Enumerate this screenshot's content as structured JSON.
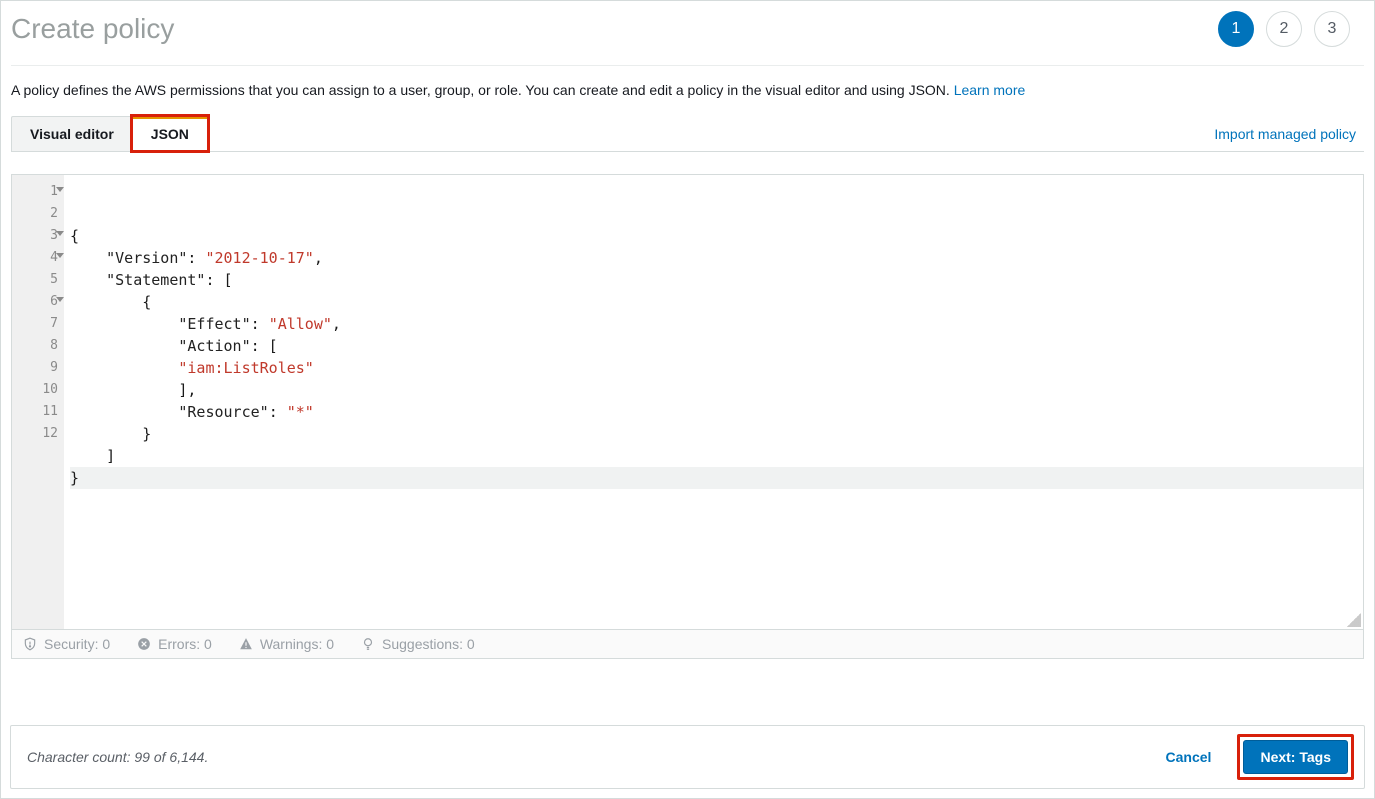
{
  "header": {
    "title": "Create policy",
    "steps": [
      "1",
      "2",
      "3"
    ],
    "activeStep": 0
  },
  "description": {
    "text": "A policy defines the AWS permissions that you can assign to a user, group, or role. You can create and edit a policy in the visual editor and using JSON. ",
    "learnMore": "Learn more"
  },
  "tabs": {
    "visual": "Visual editor",
    "json": "JSON",
    "importLink": "Import managed policy"
  },
  "editor": {
    "lineNumbers": [
      "1",
      "2",
      "3",
      "4",
      "5",
      "6",
      "7",
      "8",
      "9",
      "10",
      "11",
      "12"
    ],
    "foldLines": [
      1,
      3,
      4,
      6
    ],
    "lines": [
      {
        "indent": "",
        "parts": [
          {
            "t": "{",
            "c": "p"
          }
        ]
      },
      {
        "indent": "    ",
        "parts": [
          {
            "t": "\"Version\"",
            "c": "key"
          },
          {
            "t": ": ",
            "c": "p"
          },
          {
            "t": "\"2012-10-17\"",
            "c": "str"
          },
          {
            "t": ",",
            "c": "p"
          }
        ]
      },
      {
        "indent": "    ",
        "parts": [
          {
            "t": "\"Statement\"",
            "c": "key"
          },
          {
            "t": ": [",
            "c": "p"
          }
        ]
      },
      {
        "indent": "        ",
        "parts": [
          {
            "t": "{",
            "c": "p"
          }
        ]
      },
      {
        "indent": "            ",
        "parts": [
          {
            "t": "\"Effect\"",
            "c": "key"
          },
          {
            "t": ": ",
            "c": "p"
          },
          {
            "t": "\"Allow\"",
            "c": "str"
          },
          {
            "t": ",",
            "c": "p"
          }
        ]
      },
      {
        "indent": "            ",
        "parts": [
          {
            "t": "\"Action\"",
            "c": "key"
          },
          {
            "t": ": [",
            "c": "p"
          }
        ]
      },
      {
        "indent": "            ",
        "parts": [
          {
            "t": "\"iam:ListRoles\"",
            "c": "str"
          }
        ]
      },
      {
        "indent": "            ",
        "parts": [
          {
            "t": "],",
            "c": "p"
          }
        ]
      },
      {
        "indent": "            ",
        "parts": [
          {
            "t": "\"Resource\"",
            "c": "key"
          },
          {
            "t": ": ",
            "c": "p"
          },
          {
            "t": "\"*\"",
            "c": "str"
          }
        ]
      },
      {
        "indent": "        ",
        "parts": [
          {
            "t": "}",
            "c": "p"
          }
        ]
      },
      {
        "indent": "    ",
        "parts": [
          {
            "t": "]",
            "c": "p"
          }
        ]
      },
      {
        "indent": "",
        "parts": [
          {
            "t": "}",
            "c": "p"
          }
        ],
        "cursor": true
      }
    ]
  },
  "status": {
    "security": "Security: 0",
    "errors": "Errors: 0",
    "warnings": "Warnings: 0",
    "suggestions": "Suggestions: 0"
  },
  "footer": {
    "charCount": "Character count: 99 of 6,144.",
    "cancel": "Cancel",
    "next": "Next: Tags"
  }
}
